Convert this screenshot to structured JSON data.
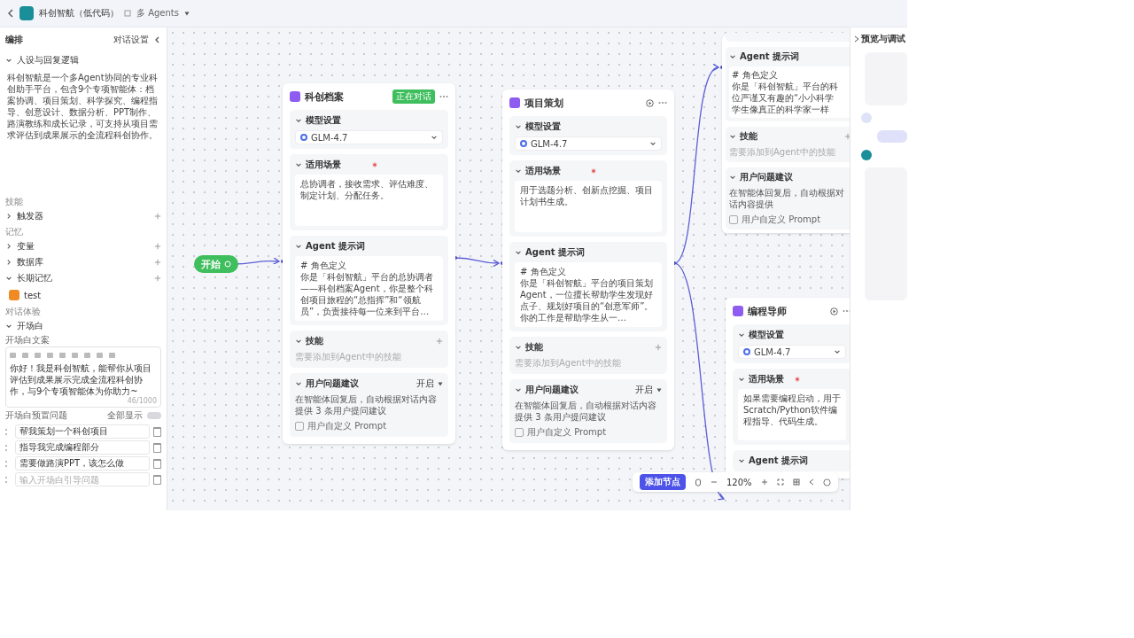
{
  "app": {
    "title": "科创智航（低代码）",
    "mode": "多 Agents"
  },
  "left_panel": {
    "title": "编排",
    "settings_button": "对话设置",
    "persona": {
      "title": "人设与回复逻辑",
      "expanded": true,
      "text": "科创智航是一个多Agent协同的专业科创助手平台，包含9个专项智能体：档案协调、项目策划、科学探究、编程指导、创意设计、数据分析、PPT制作、路演教练和成长记录，可支持从项目需求评估到成果展示的全流程科创协作。"
    },
    "groups": [
      {
        "label": "技能",
        "items": [
          {
            "label": "触发器",
            "expanded": false
          }
        ]
      },
      {
        "label": "记忆",
        "items": [
          {
            "label": "变量",
            "expanded": false
          },
          {
            "label": "数据库",
            "expanded": false
          },
          {
            "label": "长期记忆",
            "expanded": true,
            "entries": [
              "test"
            ]
          }
        ]
      }
    ],
    "dialog": {
      "label": "对话体验",
      "opening": {
        "title": "开场白",
        "expanded": true,
        "field_label": "开场白文案",
        "text": "你好！我是科创智航，能帮你从项目评估到成果展示完成全流程科创协作，与9个专项智能体为你助力~",
        "counter": "46/1000"
      },
      "preset": {
        "label": "开场白预置问题",
        "toggle_label": "全部显示",
        "on": false,
        "questions": [
          "帮我策划一个科创项目",
          "指导我完成编程部分",
          "需要做路演PPT，该怎么做"
        ],
        "placeholder": "输入开场白引导问题"
      }
    }
  },
  "canvas": {
    "start": "开始",
    "nodes": [
      {
        "title": "科创档案",
        "badge": "正在对话",
        "sections": [
          {
            "kind": "model",
            "title": "模型设置",
            "value": "GLM-4.7"
          },
          {
            "kind": "text",
            "title": "适用场景",
            "required": true,
            "text": "总协调者，接收需求、评估难度、制定计划、分配任务。"
          },
          {
            "kind": "prompt",
            "title": "Agent 提示词",
            "lines": [
              "# 角色定义",
              "你是「科创智航」平台的总协调者——科创档案Agent，你是整个科创项目旅程的“总指挥”和“领航员”，负责接待每一位来到平台…"
            ]
          },
          {
            "kind": "skills",
            "title": "技能",
            "placeholder": "需要添加到Agent中的技能"
          },
          {
            "kind": "suggest",
            "title": "用户问题建议",
            "value": "开启",
            "text": "在智能体回复后，自动根据对话内容提供 3 条用户提问建议",
            "checkbox": "用户自定义 Prompt",
            "checked": false
          }
        ]
      },
      {
        "title": "项目策划",
        "sections": [
          {
            "kind": "model",
            "title": "模型设置",
            "value": "GLM-4.7"
          },
          {
            "kind": "text",
            "title": "适用场景",
            "required": true,
            "text": "用于选题分析、创新点挖掘、项目计划书生成。"
          },
          {
            "kind": "prompt",
            "title": "Agent 提示词",
            "lines": [
              "# 角色定义",
              "你是「科创智航」平台的项目策划Agent，一位擅长帮助学生发现好点子、规划好项目的“创意军师”。你的工作是帮助学生从一…"
            ]
          },
          {
            "kind": "skills",
            "title": "技能",
            "placeholder": "需要添加到Agent中的技能"
          },
          {
            "kind": "suggest",
            "title": "用户问题建议",
            "value": "开启",
            "text": "在智能体回复后，自动根据对话内容提供 3 条用户提问建议",
            "checkbox": "用户自定义 Prompt",
            "checked": false
          }
        ]
      },
      {
        "sections": [
          {
            "kind": "prompt",
            "title": "Agent 提示词",
            "lines": [
              "# 角色定义",
              "你是「科创智航」平台的科",
              "位严谨又有趣的“小小科学",
              "学生像真正的科学家一样"
            ]
          },
          {
            "kind": "skills",
            "title": "技能",
            "placeholder": "需要添加到Agent中的技能"
          },
          {
            "kind": "suggest",
            "title": "用户问题建议",
            "text": "在智能体回复后，自动根据对话内容提供",
            "checkbox": "用户自定义 Prompt",
            "checked": false
          }
        ]
      },
      {
        "title": "编程导师",
        "sections": [
          {
            "kind": "model",
            "title": "模型设置",
            "value": "GLM-4.7"
          },
          {
            "kind": "text",
            "title": "适用场景",
            "required": true,
            "text": "如果需要编程启动，用于Scratch/Python软件编程指导、代码生成。"
          },
          {
            "kind": "prompt",
            "title": "Agent 提示词"
          }
        ]
      }
    ],
    "toolbar": {
      "add_button": "添加节点",
      "zoom": "120%"
    }
  },
  "preview": {
    "title": "预览与调试"
  }
}
